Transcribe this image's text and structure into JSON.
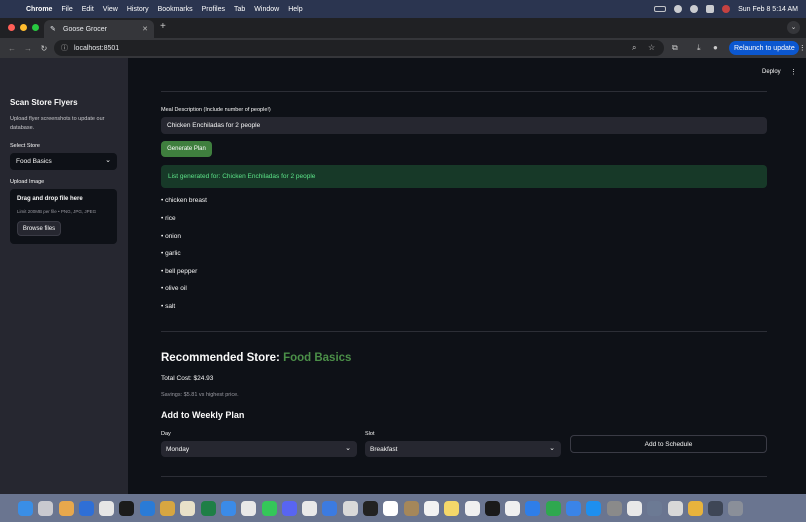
{
  "menubar": {
    "app": "Chrome",
    "items": [
      "File",
      "Edit",
      "View",
      "History",
      "Bookmarks",
      "Profiles",
      "Tab",
      "Window",
      "Help"
    ],
    "clock": "Sun Feb 8  5:14 AM"
  },
  "browser": {
    "tab_title": "Goose Grocer",
    "url": "localhost:8501",
    "relaunch_label": "Relaunch to update"
  },
  "sidebar": {
    "title": "Scan Store Flyers",
    "description": "Upload flyer screenshots to update our database.",
    "select_label": "Select Store",
    "selected_store": "Food Basics",
    "upload_label": "Upload Image",
    "drop_title": "Drag and drop file here",
    "drop_limit": "Limit 200MB per file • PNG, JPG, JPEG",
    "browse_label": "Browse files"
  },
  "header": {
    "deploy_label": "Deploy"
  },
  "main": {
    "meal_label": "Meal Description (Include number of people!)",
    "meal_value": "Chicken Enchiladas for 2 people",
    "generate_label": "Generate Plan",
    "success_message": "List generated for: Chicken Enchiladas for 2 people",
    "ingredients": [
      "• chicken breast",
      "• rice",
      "• onion",
      "• garlic",
      "• bell pepper",
      "• olive oil",
      "• salt"
    ],
    "recommended_prefix": "Recommended Store: ",
    "recommended_store": "Food Basics",
    "total_cost": "Total Cost: $24.93",
    "savings": "Savings: $5.81 vs highest price.",
    "weekly_title": "Add to Weekly Plan",
    "day_label": "Day",
    "day_value": "Monday",
    "slot_label": "Slot",
    "slot_value": "Breakfast",
    "schedule_label": "Add to Schedule"
  },
  "dock": {
    "icons": [
      "finder-icon",
      "launchpad-icon",
      "photos-icon",
      "settings-icon",
      "app-icon",
      "terminal-app-icon",
      "vscode-icon",
      "python-icon",
      "preview-icon",
      "excel-icon",
      "safari-icon",
      "chrome-icon",
      "messages-icon",
      "discord-icon",
      "slack-icon",
      "mail-icon",
      "browser-icon",
      "terminal-icon",
      "calendar-icon",
      "notes-icon",
      "reminders-icon",
      "notes-yellow-icon",
      "freeform-icon",
      "appletv-icon",
      "music-icon",
      "files-icon",
      "numbers-icon",
      "keynote-icon",
      "appstore-icon",
      "system-settings-icon",
      "pencil-icon",
      "preview-doc-icon",
      "image-icon",
      "pages-icon",
      "downloads-icon",
      "trash-icon"
    ],
    "colors": [
      "#3a8ee6",
      "#c9c9cf",
      "#e8a84c",
      "#2f6fd6",
      "#e6e6e6",
      "#1b1b1b",
      "#2a7bd6",
      "#d7a641",
      "#e8e1c9",
      "#1e7f46",
      "#3b8be8",
      "#e8e8e8",
      "#34c759",
      "#5865f2",
      "#e9e9e9",
      "#3c7be0",
      "#d9d9d9",
      "#222222",
      "#ffffff",
      "#a5875a",
      "#f2f2f2",
      "#f5d86a",
      "#f0f0f0",
      "#1a1a1a",
      "#f0f0f0",
      "#2f7ee8",
      "#2fa84f",
      "#3a84e8",
      "#1e8fef",
      "#8a8a8a",
      "#e8e8e8",
      "#6c7a94",
      "#d8d8d8",
      "#e8b33c",
      "#3e4656",
      "#8a8f99"
    ]
  },
  "colors": {
    "accent_green": "#3f7f3e",
    "store_green": "#4b8f48",
    "success_text": "#5ce488",
    "success_bg": "#173928",
    "page_bg": "#0e1117",
    "sidebar_bg": "#262730",
    "relaunch_blue": "#0b57d0"
  }
}
